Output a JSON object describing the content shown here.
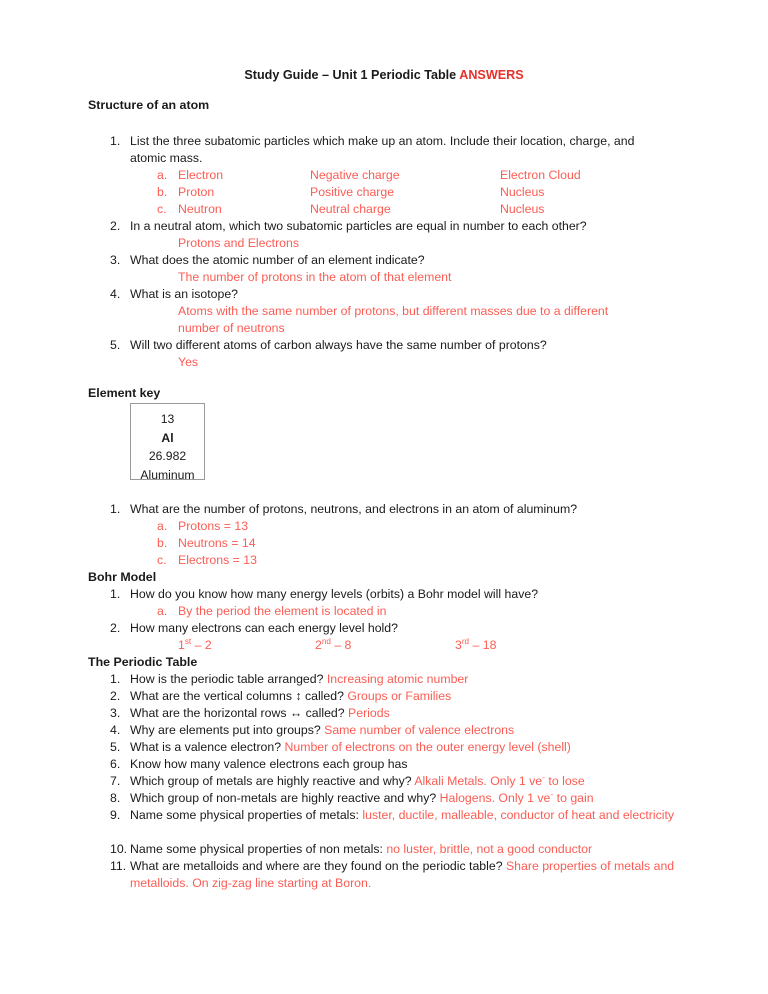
{
  "document": {
    "title_plain": "Study Guide – Unit 1 Periodic Table ",
    "title_answers": "ANSWERS",
    "answer_color": "#FC5C53",
    "answers_label_color": "#E8312A"
  },
  "sections": {
    "structure": {
      "heading": "Structure of an atom",
      "q1": {
        "number": "1.",
        "text_line1": "List the three subatomic particles which make up an atom. Include their location, charge, and",
        "text_line2": "atomic mass.",
        "rows": [
          {
            "letter": "a.",
            "particle": "Electron",
            "charge": "Negative charge",
            "location": "Electron Cloud"
          },
          {
            "letter": "b.",
            "particle": "Proton",
            "charge": "Positive charge",
            "location": "Nucleus"
          },
          {
            "letter": "c.",
            "particle": "Neutron",
            "charge": "Neutral charge",
            "location": "Nucleus"
          }
        ]
      },
      "q2": {
        "number": "2.",
        "text": "In a neutral atom, which two subatomic particles are equal in number to each other?",
        "answer": "Protons and Electrons"
      },
      "q3": {
        "number": "3.",
        "text": "What does the atomic number of an element indicate?",
        "answer": "The number of protons in the atom of that element"
      },
      "q4": {
        "number": "4.",
        "text": "What is an isotope?",
        "answer_line1": "Atoms with the same number of protons, but different masses due to a different",
        "answer_line2": "number of neutrons"
      },
      "q5": {
        "number": "5.",
        "text": "Will two different atoms of carbon always have the same number of protons?",
        "answer": "Yes"
      }
    },
    "element_key": {
      "heading": "Element key",
      "tile": {
        "atomic_number": "13",
        "symbol": "Al",
        "atomic_mass": "26.982",
        "name": "Aluminum"
      },
      "q1": {
        "number": "1.",
        "text": "What are the number of protons, neutrons, and electrons in an atom of aluminum?",
        "answers": [
          {
            "letter": "a.",
            "text": "Protons = 13"
          },
          {
            "letter": "b.",
            "text": "Neutrons = 14"
          },
          {
            "letter": "c.",
            "text": "Electrons = 13"
          }
        ]
      }
    },
    "bohr": {
      "heading": "Bohr Model",
      "q1": {
        "number": "1.",
        "text": "How do you know how many energy levels (orbits) a Bohr model will have?",
        "answer_letter": "a.",
        "answer": "By the period the element is located in"
      },
      "q2": {
        "number": "2.",
        "text": "How many electrons can each energy level hold?",
        "levels": [
          {
            "ordinal": "1",
            "suffix": "st",
            "value": " – 2"
          },
          {
            "ordinal": "2",
            "suffix": "nd",
            "value": " – 8"
          },
          {
            "ordinal": "3",
            "suffix": "rd",
            "value": " – 18"
          }
        ]
      }
    },
    "periodic_table": {
      "heading": "The Periodic Table",
      "items": [
        {
          "number": "1.",
          "question": "How is the periodic table arranged? ",
          "answer": "Increasing atomic number"
        },
        {
          "number": "2.",
          "question": "What are the vertical columns ↕ called? ",
          "answer": "Groups or Families"
        },
        {
          "number": "3.",
          "question": "What are the horizontal rows ↔ called? ",
          "answer": "Periods"
        },
        {
          "number": "4.",
          "question": "Why are elements put into groups? ",
          "answer": "Same number of valence electrons"
        },
        {
          "number": "5.",
          "question": "What is a valence electron? ",
          "answer": "Number of electrons on the outer energy level (shell)"
        },
        {
          "number": "6.",
          "question": "Know how many valence electrons each group has",
          "answer": ""
        },
        {
          "number": "7.",
          "question": "Which group of metals are highly reactive and why? ",
          "answer_pre": "Alkali Metals. Only 1 ve",
          "answer_sup": "-",
          "answer_post": " to lose"
        },
        {
          "number": "8.",
          "question": "Which group of non-metals are highly reactive and why? ",
          "answer_pre": "Halogens. Only 1 ve",
          "answer_sup": "-",
          "answer_post": " to gain"
        },
        {
          "number": "9.",
          "question": "Name some physical properties of metals: ",
          "answer": "luster, ductile, malleable, conductor of heat and electricity"
        },
        {
          "number": "10.",
          "question": "Name some physical properties of non metals: ",
          "answer": "no luster, brittle, not a good conductor"
        },
        {
          "number": "11.",
          "question": "What are metalloids and where are they found on the periodic table? ",
          "answer": "Share properties of metals and metalloids. On zig-zag line starting at Boron."
        }
      ]
    }
  }
}
